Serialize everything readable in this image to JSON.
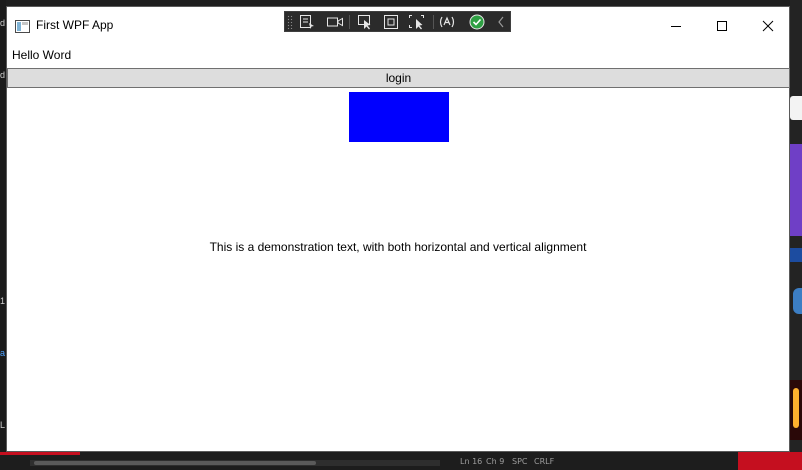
{
  "window": {
    "title": "First WPF App",
    "caption_buttons": {
      "minimize_icon": "minimize-icon",
      "maximize_icon": "maximize-icon",
      "close_icon": "close-icon"
    }
  },
  "debug_toolbar": {
    "icons": [
      "select-element-icon",
      "record-icon",
      "pointer-select-icon",
      "display-adorners-icon",
      "track-focus-icon",
      "hot-reload-icon",
      "check-icon",
      "collapse-chevron-icon"
    ],
    "colors": {
      "check": "#2ea043",
      "background": "#2b2b2b"
    }
  },
  "content": {
    "hello_text": "Hello Word",
    "login_button": "login",
    "demo_text": "This is a demonstration text, with both horizontal and vertical alignment"
  },
  "colors": {
    "rectangle_fill": "#0000ff",
    "button_background": "#dddddd"
  },
  "background": {
    "status_items": [
      "Ln 16",
      "Ch 9",
      "SPC",
      "CRLF"
    ]
  }
}
